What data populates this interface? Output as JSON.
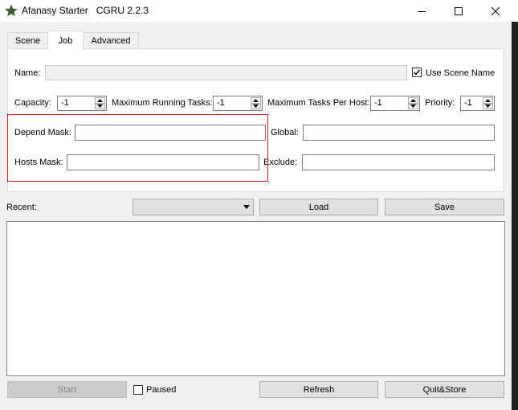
{
  "window": {
    "app_name": "Afanasy Starter",
    "version": "CGRU 2.2.3"
  },
  "tabs": [
    {
      "label": "Scene",
      "active": false
    },
    {
      "label": "Job",
      "active": true
    },
    {
      "label": "Advanced",
      "active": false
    }
  ],
  "job": {
    "name_label": "Name:",
    "name_value": "",
    "use_scene_name_label": "Use Scene Name",
    "use_scene_name_checked": true,
    "capacity_label": "Capacity:",
    "capacity_value": "-1",
    "max_running_label": "Maximum Running Tasks:",
    "max_running_value": "-1",
    "max_per_host_label": "Maximum Tasks Per Host:",
    "max_per_host_value": "-1",
    "priority_label": "Priority:",
    "priority_value": "-1",
    "depend_mask_label": "Depend Mask:",
    "depend_mask_value": "",
    "global_label": "Global:",
    "global_value": "",
    "hosts_mask_label": "Hosts Mask:",
    "hosts_mask_value": "",
    "exclude_label": "Exclude:",
    "exclude_value": ""
  },
  "recent": {
    "label": "Recent:",
    "selected": ""
  },
  "buttons": {
    "load": "Load",
    "save": "Save",
    "start": "Start",
    "paused": "Paused",
    "refresh": "Refresh",
    "quit_store": "Quit&Store"
  },
  "log_text": "",
  "colors": {
    "highlight": "#d92020",
    "window_bg": "#f0f0f0"
  }
}
